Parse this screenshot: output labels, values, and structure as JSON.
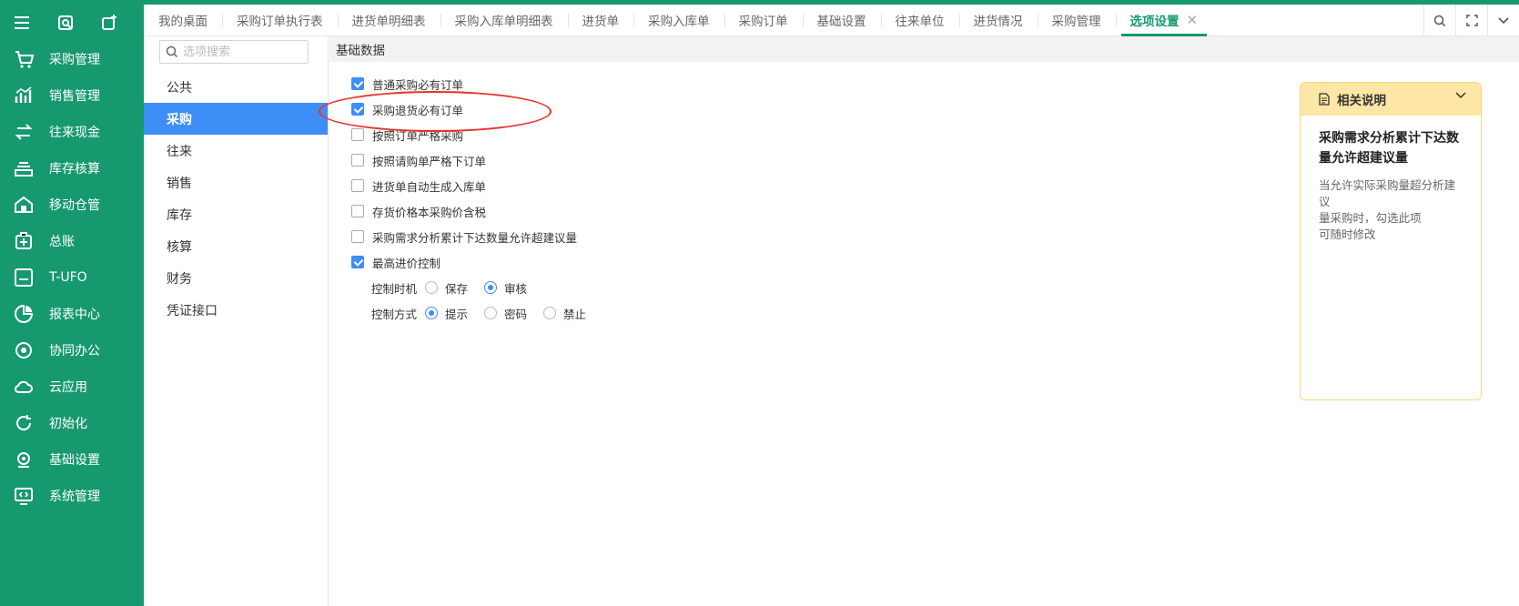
{
  "sidebar": {
    "top_icons": [
      "menu-icon",
      "refresh-search-icon",
      "add-window-icon"
    ],
    "items": [
      {
        "label": "采购管理",
        "icon": "cart-icon"
      },
      {
        "label": "销售管理",
        "icon": "sales-chart-icon"
      },
      {
        "label": "往来现金",
        "icon": "exchange-icon"
      },
      {
        "label": "库存核算",
        "icon": "inventory-icon"
      },
      {
        "label": "移动仓管",
        "icon": "mobile-warehouse-icon"
      },
      {
        "label": "总账",
        "icon": "ledger-icon"
      },
      {
        "label": "T-UFO",
        "icon": "ufo-icon"
      },
      {
        "label": "报表中心",
        "icon": "pie-chart-icon"
      },
      {
        "label": "协同办公",
        "icon": "collaboration-icon"
      },
      {
        "label": "云应用",
        "icon": "cloud-icon"
      },
      {
        "label": "初始化",
        "icon": "refresh-icon"
      },
      {
        "label": "基础设置",
        "icon": "base-settings-icon"
      },
      {
        "label": "系统管理",
        "icon": "system-monitor-icon"
      }
    ]
  },
  "tabs": [
    {
      "label": "我的桌面"
    },
    {
      "label": "采购订单执行表"
    },
    {
      "label": "进货单明细表"
    },
    {
      "label": "采购入库单明细表"
    },
    {
      "label": "进货单"
    },
    {
      "label": "采购入库单"
    },
    {
      "label": "采购订单"
    },
    {
      "label": "基础设置"
    },
    {
      "label": "往来单位"
    },
    {
      "label": "进货情况"
    },
    {
      "label": "采购管理"
    },
    {
      "label": "选项设置",
      "active": true,
      "close": "✕"
    }
  ],
  "search": {
    "placeholder": "选项搜索",
    "value": ""
  },
  "categories": [
    "公共",
    "采购",
    "往来",
    "销售",
    "库存",
    "核算",
    "财务",
    "凭证接口"
  ],
  "active_category": "采购",
  "section_title": "基础数据",
  "options": [
    {
      "label": "普通采购必有订单",
      "checked": true
    },
    {
      "label": "采购退货必有订单",
      "checked": true
    },
    {
      "label": "按照订单严格采购",
      "checked": false
    },
    {
      "label": "按照请购单严格下订单",
      "checked": false
    },
    {
      "label": "进货单自动生成入库单",
      "checked": false
    },
    {
      "label": "存货价格本采购价含税",
      "checked": false
    },
    {
      "label": "采购需求分析累计下达数量允许超建议量",
      "checked": false
    },
    {
      "label": "最高进价控制",
      "checked": true
    }
  ],
  "control_timing": {
    "label": "控制时机",
    "options": [
      {
        "label": "保存",
        "selected": false
      },
      {
        "label": "审核",
        "selected": true
      }
    ]
  },
  "control_method": {
    "label": "控制方式",
    "options": [
      {
        "label": "提示",
        "selected": true
      },
      {
        "label": "密码",
        "selected": false
      },
      {
        "label": "禁止",
        "selected": false
      }
    ]
  },
  "note": {
    "header": "相关说明",
    "title": "采购需求分析累计下达数量允许超建议量",
    "desc_lines": [
      "当允许实际采购量超分析建议",
      "量采购时，勾选此项",
      "可随时修改"
    ]
  },
  "colors": {
    "brand": "#17996f",
    "accent": "#3e8ef7",
    "note_bg": "#fde6a6",
    "highlight": "#e8312c"
  }
}
